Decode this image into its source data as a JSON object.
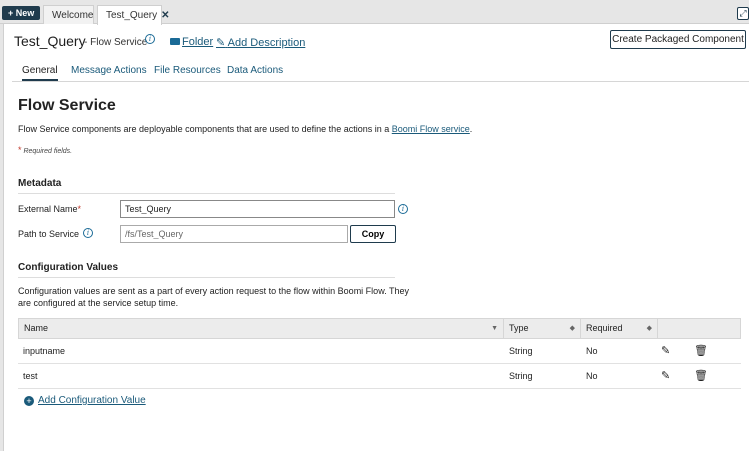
{
  "tabstrip": {
    "new_label": "+ New",
    "tabs": [
      {
        "label": "Welcome"
      },
      {
        "label": "Test_Query",
        "close": "✕"
      }
    ]
  },
  "header": {
    "title": "Test_Query",
    "subtitle": "- Flow Service",
    "folder_label": "Folder",
    "add_description_label": "Add Description",
    "create_packaged_label": "Create Packaged Component"
  },
  "subtabs": [
    {
      "label": "General",
      "active": true
    },
    {
      "label": "Message Actions"
    },
    {
      "label": "File Resources"
    },
    {
      "label": "Data Actions"
    }
  ],
  "main": {
    "heading": "Flow Service",
    "intro_text": "Flow Service components are deployable components that are used to define the actions in a",
    "intro_link": "Boomi Flow service",
    "intro_end": ".",
    "required_text": "Required fields."
  },
  "metadata": {
    "section_title": "Metadata",
    "external_name_label": "External Name",
    "external_name_value": "Test_Query",
    "path_label": "Path to Service",
    "path_value": "/fs/Test_Query",
    "copy_label": "Copy"
  },
  "config": {
    "section_title": "Configuration Values",
    "description": "Configuration values are sent as a part of every action request to the flow within Boomi Flow. They are configured at the service setup time.",
    "columns": [
      "Name",
      "Type",
      "Required"
    ],
    "rows": [
      {
        "name": "inputname",
        "type": "String",
        "required": "No"
      },
      {
        "name": "test",
        "type": "String",
        "required": "No"
      }
    ],
    "add_label": "Add Configuration Value"
  },
  "icons": {
    "info": "info-icon",
    "folder": "folder-icon",
    "edit": "pencil-icon",
    "delete": "trash-icon",
    "add": "plus-circle-icon",
    "expand": "expand-icon"
  },
  "colors": {
    "accent": "#1f3b4d",
    "link": "#1a5a7a",
    "required": "#c0392b"
  }
}
